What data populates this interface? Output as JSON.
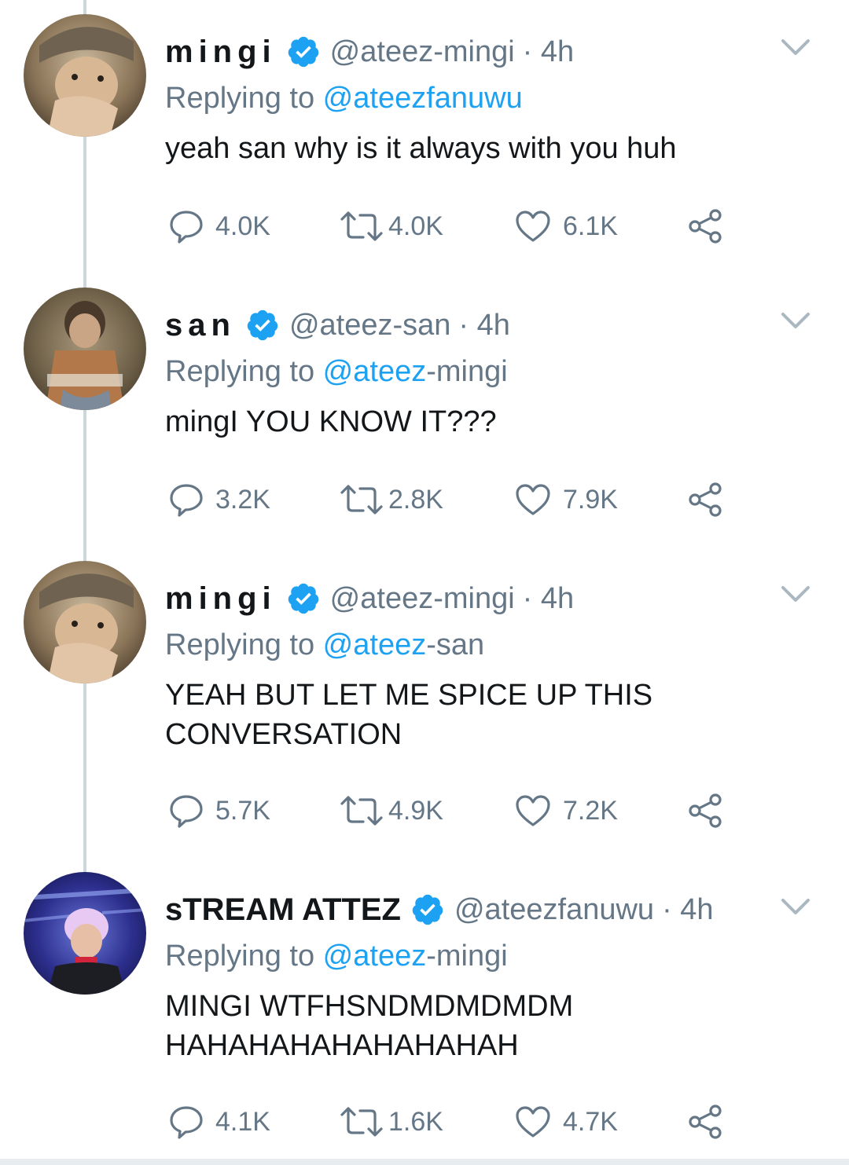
{
  "colors": {
    "verified": "#1da1f2",
    "mention": "#1da1f2",
    "secondary_text": "#657786",
    "primary_text": "#14171a",
    "thread_line": "#ccd6dd"
  },
  "tweets": [
    {
      "name": "mingi",
      "handle": "@ateez-mingi",
      "time": "· 4h",
      "reply_prefix": "Replying to ",
      "reply_mention": "@ateezfanuwu",
      "reply_rest": "",
      "text": "yeah san why is it always with you huh",
      "replies": "4.0K",
      "retweets": "4.0K",
      "likes": "6.1K",
      "avatar_icon": "avatar-photo"
    },
    {
      "name": "san",
      "handle": "@ateez-san",
      "time": "· 4h",
      "reply_prefix": "Replying to ",
      "reply_mention": "@ateez",
      "reply_rest": "-mingi",
      "text": "mingI YOU KNOW IT???",
      "replies": "3.2K",
      "retweets": "2.8K",
      "likes": "7.9K",
      "avatar_icon": "avatar-photo"
    },
    {
      "name": "mingi",
      "handle": "@ateez-mingi",
      "time": "· 4h",
      "reply_prefix": "Replying to ",
      "reply_mention": "@ateez",
      "reply_rest": "-san",
      "text": "YEAH BUT LET ME SPICE UP THIS CONVERSATION",
      "replies": "5.7K",
      "retweets": "4.9K",
      "likes": "7.2K",
      "avatar_icon": "avatar-photo"
    },
    {
      "name": "sTREAM ATTEZ",
      "handle": "@ateezfanuwu",
      "time": "· 4h",
      "reply_prefix": "Replying to ",
      "reply_mention": "@ateez",
      "reply_rest": "-mingi",
      "text": "MINGI WTFHSNDMDMDMDM HAHAHAHAHAHAHAHAH",
      "replies": "4.1K",
      "retweets": "1.6K",
      "likes": "4.7K",
      "avatar_icon": "avatar-photo"
    }
  ]
}
